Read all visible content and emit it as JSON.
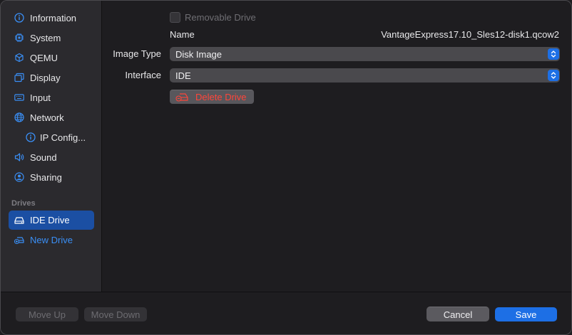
{
  "sidebar": {
    "items": [
      {
        "label": "Information",
        "icon": "info-icon"
      },
      {
        "label": "System",
        "icon": "chip-icon"
      },
      {
        "label": "QEMU",
        "icon": "cube-icon"
      },
      {
        "label": "Display",
        "icon": "display-icon"
      },
      {
        "label": "Input",
        "icon": "keyboard-icon"
      },
      {
        "label": "Network",
        "icon": "globe-icon"
      },
      {
        "label": "IP Config...",
        "icon": "info-icon"
      },
      {
        "label": "Sound",
        "icon": "speaker-icon"
      },
      {
        "label": "Sharing",
        "icon": "person-icon"
      }
    ],
    "drives_section": "Drives",
    "drive_items": [
      {
        "label": "IDE Drive",
        "icon": "drive-icon"
      },
      {
        "label": "New Drive",
        "icon": "add-drive-icon"
      }
    ]
  },
  "main": {
    "removable_label": "Removable Drive",
    "name_label": "Name",
    "name_value": "VantageExpress17.10_Sles12-disk1.qcow2",
    "image_type_label": "Image Type",
    "image_type_value": "Disk Image",
    "interface_label": "Interface",
    "interface_value": "IDE",
    "delete_label": "Delete Drive"
  },
  "footer": {
    "move_up": "Move Up",
    "move_down": "Move Down",
    "cancel": "Cancel",
    "save": "Save"
  },
  "colors": {
    "accent": "#1d6fe5",
    "selected": "#1b4fa3",
    "link": "#3a8ff6",
    "danger": "#ff453a"
  }
}
